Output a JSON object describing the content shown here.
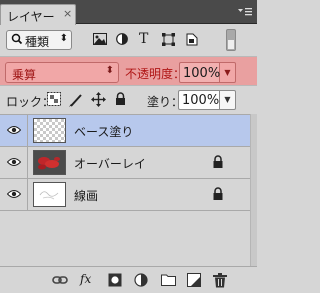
{
  "tab": {
    "label": "レイヤー",
    "close": "×"
  },
  "panel_menu_glyph": "▾≡",
  "filter": {
    "kind_value": "種類",
    "icons": [
      "pixel-filter-icon",
      "adjustment-filter-icon",
      "type-filter-icon",
      "shape-filter-icon",
      "smart-object-filter-icon"
    ]
  },
  "blend": {
    "mode": "乗算",
    "opacity_label": "不透明度：",
    "opacity_value": "100%",
    "highlight_color": "#e9a0a0",
    "text_color": "#b01616"
  },
  "lock": {
    "label": "ロック：",
    "fill_label": "塗り：",
    "fill_value": "100%"
  },
  "layers": [
    {
      "name": "ベース塗り",
      "selected": true,
      "locked": false,
      "thumb": "transparent"
    },
    {
      "name": "オーバーレイ",
      "selected": false,
      "locked": true,
      "thumb": "red-marks"
    },
    {
      "name": "線画",
      "selected": false,
      "locked": true,
      "thumb": "white-sketch"
    }
  ],
  "bottom_tools": [
    "link-layers-icon",
    "fx-icon",
    "layer-mask-icon",
    "adjustment-layer-icon",
    "new-group-icon",
    "new-layer-icon",
    "trash-icon"
  ],
  "fx_label": "fx",
  "colors": {
    "selection": "#b7c8ec",
    "panel_bg": "#d6d6d6",
    "tabbar_bg": "#4a4a4a"
  }
}
